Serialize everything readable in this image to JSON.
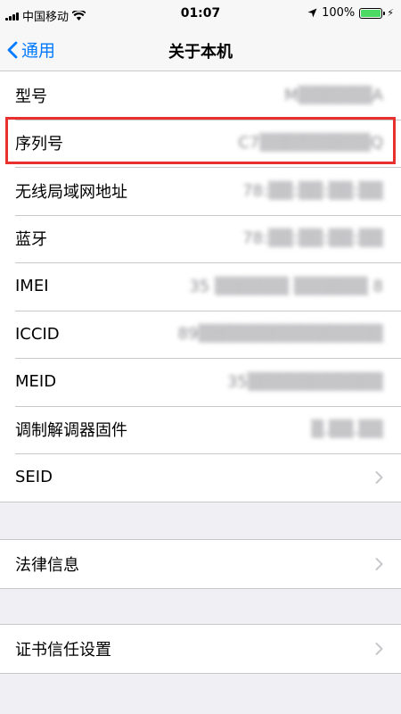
{
  "status_bar": {
    "carrier": "中国移动",
    "time": "01:07",
    "battery_percent": "100%",
    "battery_color": "#4cd964"
  },
  "nav": {
    "back_label": "通用",
    "title": "关于本机"
  },
  "info_rows": [
    {
      "label": "型号",
      "value": "M▒▒▒▒▒▒A"
    },
    {
      "label": "序列号",
      "value": "C7▒▒▒▒▒▒▒▒▒Q"
    },
    {
      "label": "无线局域网地址",
      "value": "78:▒▒:▒▒:▒▒:▒▒"
    },
    {
      "label": "蓝牙",
      "value": "78:▒▒:▒▒:▒▒:▒▒"
    },
    {
      "label": "IMEI",
      "value": "35 ▒▒▒▒▒▒ ▒▒▒▒▒▒ 8"
    },
    {
      "label": "ICCID",
      "value": "89▒▒▒▒▒▒▒▒▒▒▒▒▒▒▒"
    },
    {
      "label": "MEID",
      "value": "35▒▒▒▒▒▒▒▒▒▒▒"
    },
    {
      "label": "调制解调器固件",
      "value": "▒.▒▒.▒▒"
    },
    {
      "label": "SEID",
      "value": ""
    }
  ],
  "legal": {
    "label": "法律信息"
  },
  "certs": {
    "label": "证书信任设置"
  },
  "accent_color": "#007aff",
  "highlight_color": "#e8312f"
}
